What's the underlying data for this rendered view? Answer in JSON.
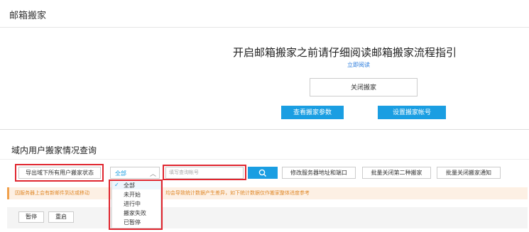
{
  "page": {
    "title": "邮箱搬家"
  },
  "guide": {
    "heading": "开启邮箱搬家之前请仔细阅读邮箱搬家流程指引",
    "read_link": "立即阅读",
    "close_button": "关闭搬家",
    "params_button": "查看搬家参数",
    "account_button": "设置搬家帐号"
  },
  "query": {
    "section_title": "域内用户搬家情况查询",
    "export_button": "导出域下所有用户搬家状态",
    "status_select": {
      "selected": "全部",
      "options": [
        "全部",
        "未开始",
        "进行中",
        "搬家失败",
        "已暂停"
      ]
    },
    "search": {
      "placeholder": "填写查询帐号"
    },
    "server_button": "修改服务器地址和端口",
    "batch_close_second": "批量关闭第二种搬家",
    "batch_close_notice": "批量关闭搬家通知"
  },
  "warning": {
    "text_left": "因服务器上会有新邮件到达或移动",
    "text_right": "均会导致统计数据产生差异，如下统计数据仅作搬家整体进度参考"
  },
  "bottom": {
    "pause_button": "暂停",
    "restart_button": "重启"
  },
  "colors": {
    "accent": "#1a9ee2",
    "highlight": "#e0262f",
    "warning": "#e08a2c"
  }
}
